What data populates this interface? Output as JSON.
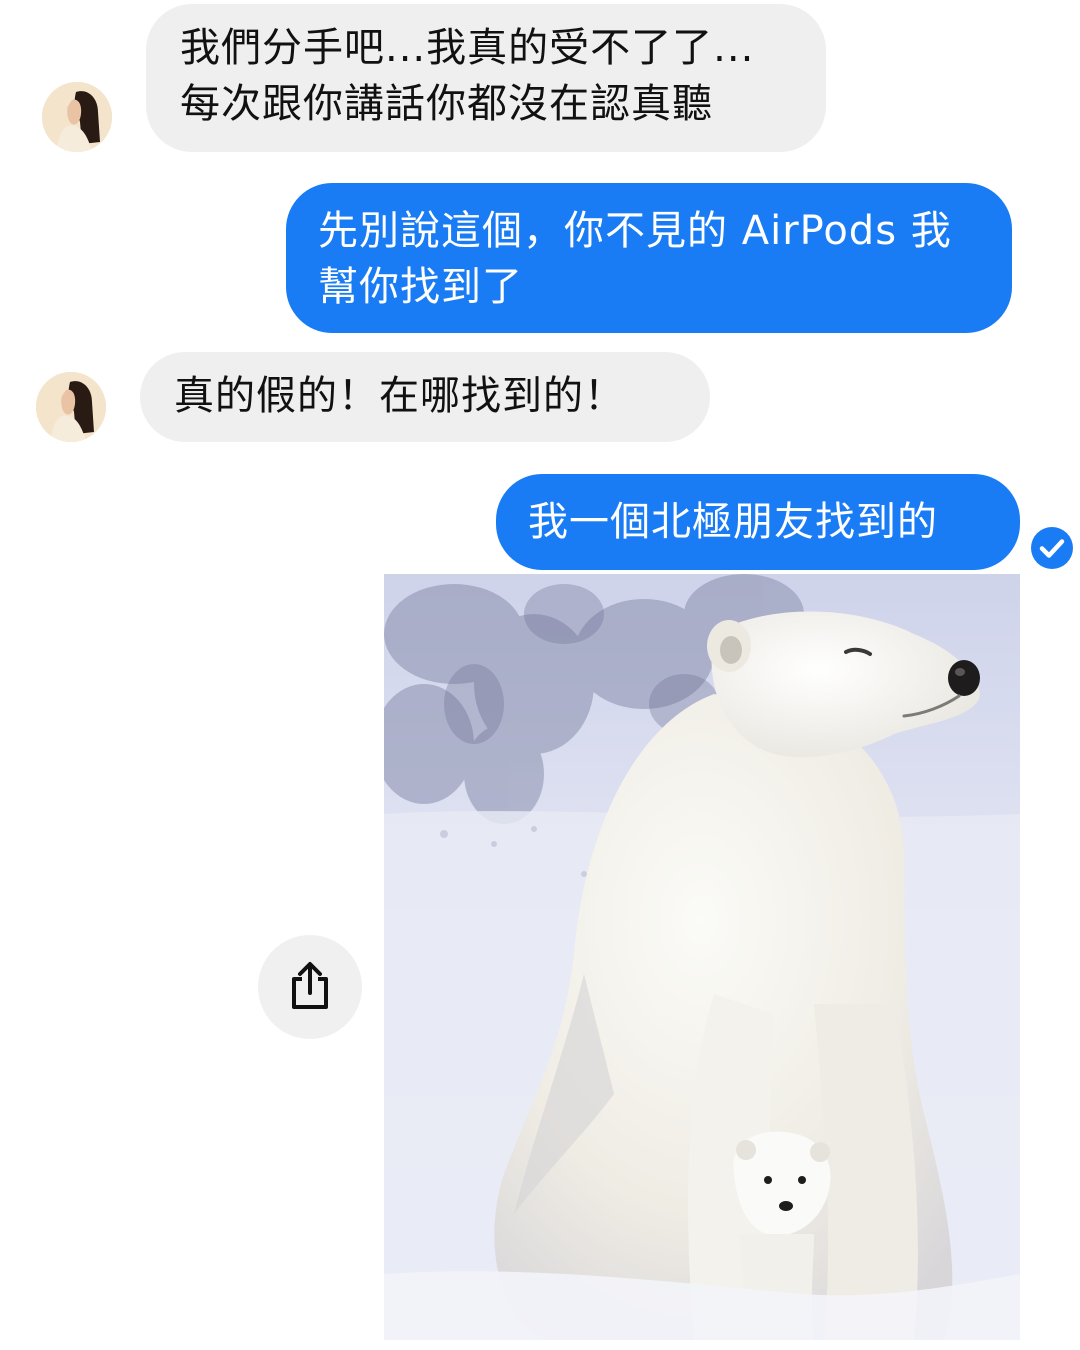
{
  "conversation": {
    "messages": [
      {
        "sender": "other",
        "lines": [
          "我們分手吧...我真的受不了了...",
          "每次跟你講話你都沒在認真聽"
        ]
      },
      {
        "sender": "self",
        "lines": [
          "先別說這個，你不見的 AirPods 我",
          "幫你找到了"
        ]
      },
      {
        "sender": "other",
        "lines": [
          "真的假的！在哪找到的！"
        ]
      },
      {
        "sender": "self",
        "lines": [
          "我一個北極朋友找到的"
        ]
      }
    ],
    "attachment": {
      "type": "photo",
      "subject": "polar-bear-with-cub"
    }
  },
  "colors": {
    "outgoing_bubble": "#1a7cf4",
    "incoming_bubble": "#efefef",
    "read_receipt": "#1a7cf4"
  },
  "icons": {
    "read_receipt": "check-circle-icon",
    "share": "share-icon"
  }
}
